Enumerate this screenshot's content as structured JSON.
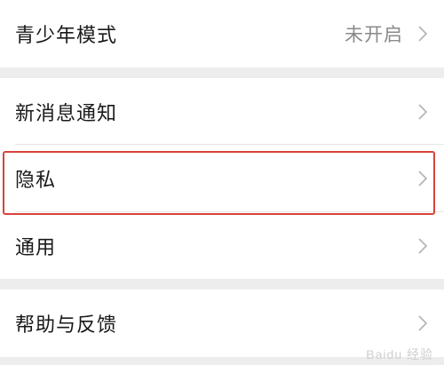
{
  "groups": [
    {
      "items": [
        {
          "label": "青少年模式",
          "value": "未开启"
        }
      ]
    },
    {
      "items": [
        {
          "label": "新消息通知"
        },
        {
          "label": "隐私"
        },
        {
          "label": "通用"
        }
      ]
    },
    {
      "items": [
        {
          "label": "帮助与反馈"
        }
      ]
    }
  ],
  "colors": {
    "page_background": "#ededed",
    "highlight_border": "#d9433a",
    "secondary_text": "#8a8a8a"
  },
  "watermark": "Baidu 经验"
}
